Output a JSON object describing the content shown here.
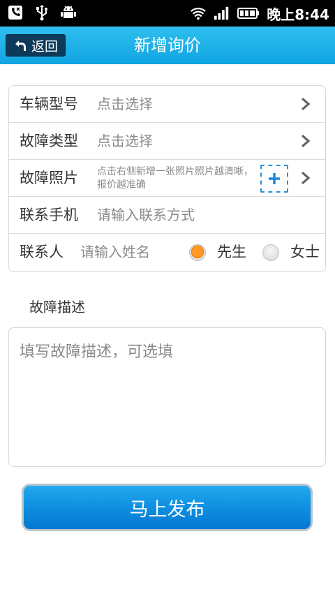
{
  "status_bar": {
    "time": "晚上8:44",
    "icons": [
      "missed-call-icon",
      "usb-icon",
      "android-debug-icon",
      "wifi-icon",
      "signal-icon",
      "battery-icon"
    ]
  },
  "title_bar": {
    "back_label": "返回",
    "title": "新增询价"
  },
  "form": {
    "vehicle_model": {
      "label": "车辆型号",
      "value": "点击选择"
    },
    "fault_type": {
      "label": "故障类型",
      "value": "点击选择"
    },
    "fault_photo": {
      "label": "故障照片",
      "hint": "点击右侧新增一张照片照片越清晰，报价越准确"
    },
    "phone": {
      "label": "联系手机",
      "placeholder": "请输入联系方式"
    },
    "contact": {
      "label": "联系人",
      "placeholder": "请输入姓名",
      "option_male": "先生",
      "option_female": "女士",
      "selected": "先生"
    }
  },
  "description": {
    "title": "故障描述",
    "placeholder": "填写故障描述，可选填"
  },
  "publish_label": "马上发布",
  "colors": {
    "title_bar": "#10a4e2",
    "back_button": "#0d3a5a",
    "accent_blue": "#0e8fe1",
    "radio_selected": "#f07d0a"
  }
}
